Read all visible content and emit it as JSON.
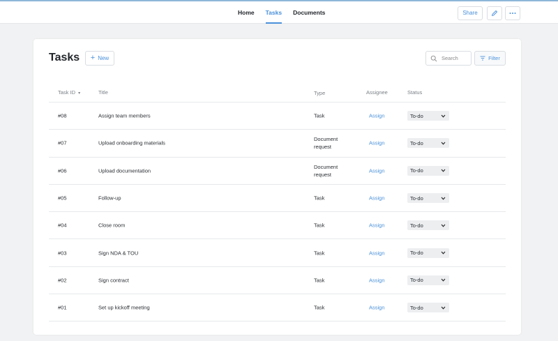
{
  "nav": {
    "items": [
      {
        "label": "Home",
        "active": false
      },
      {
        "label": "Tasks",
        "active": true
      },
      {
        "label": "Documents",
        "active": false
      }
    ],
    "share_label": "Share",
    "edit_icon": "pencil-icon",
    "more_icon": "more-horizontal-icon"
  },
  "page": {
    "title": "Tasks",
    "new_label": "New",
    "search_placeholder": "Search",
    "filter_label": "Filter"
  },
  "table": {
    "headers": {
      "id": "Task ID",
      "title": "Title",
      "type": "Type",
      "assignee": "Assignee",
      "status": "Status"
    },
    "rows": [
      {
        "id": "#08",
        "title": "Assign team members",
        "type": "Task",
        "assignee": "Assign",
        "status": "To-do"
      },
      {
        "id": "#07",
        "title": "Upload onboarding materials",
        "type": "Document request",
        "assignee": "Assign",
        "status": "To-do"
      },
      {
        "id": "#06",
        "title": "Upload documentation",
        "type": "Document request",
        "assignee": "Assign",
        "status": "To-do"
      },
      {
        "id": "#05",
        "title": "Follow-up",
        "type": "Task",
        "assignee": "Assign",
        "status": "To-do"
      },
      {
        "id": "#04",
        "title": "Close room",
        "type": "Task",
        "assignee": "Assign",
        "status": "To-do"
      },
      {
        "id": "#03",
        "title": "Sign NDA & TOU",
        "type": "Task",
        "assignee": "Assign",
        "status": "To-do"
      },
      {
        "id": "#02",
        "title": "Sign contract",
        "type": "Task",
        "assignee": "Assign",
        "status": "To-do"
      },
      {
        "id": "#01",
        "title": "Set up kickoff meeting",
        "type": "Task",
        "assignee": "Assign",
        "status": "To-do"
      }
    ]
  },
  "colors": {
    "accent": "#4a90d9",
    "background": "#f1f2f3"
  }
}
